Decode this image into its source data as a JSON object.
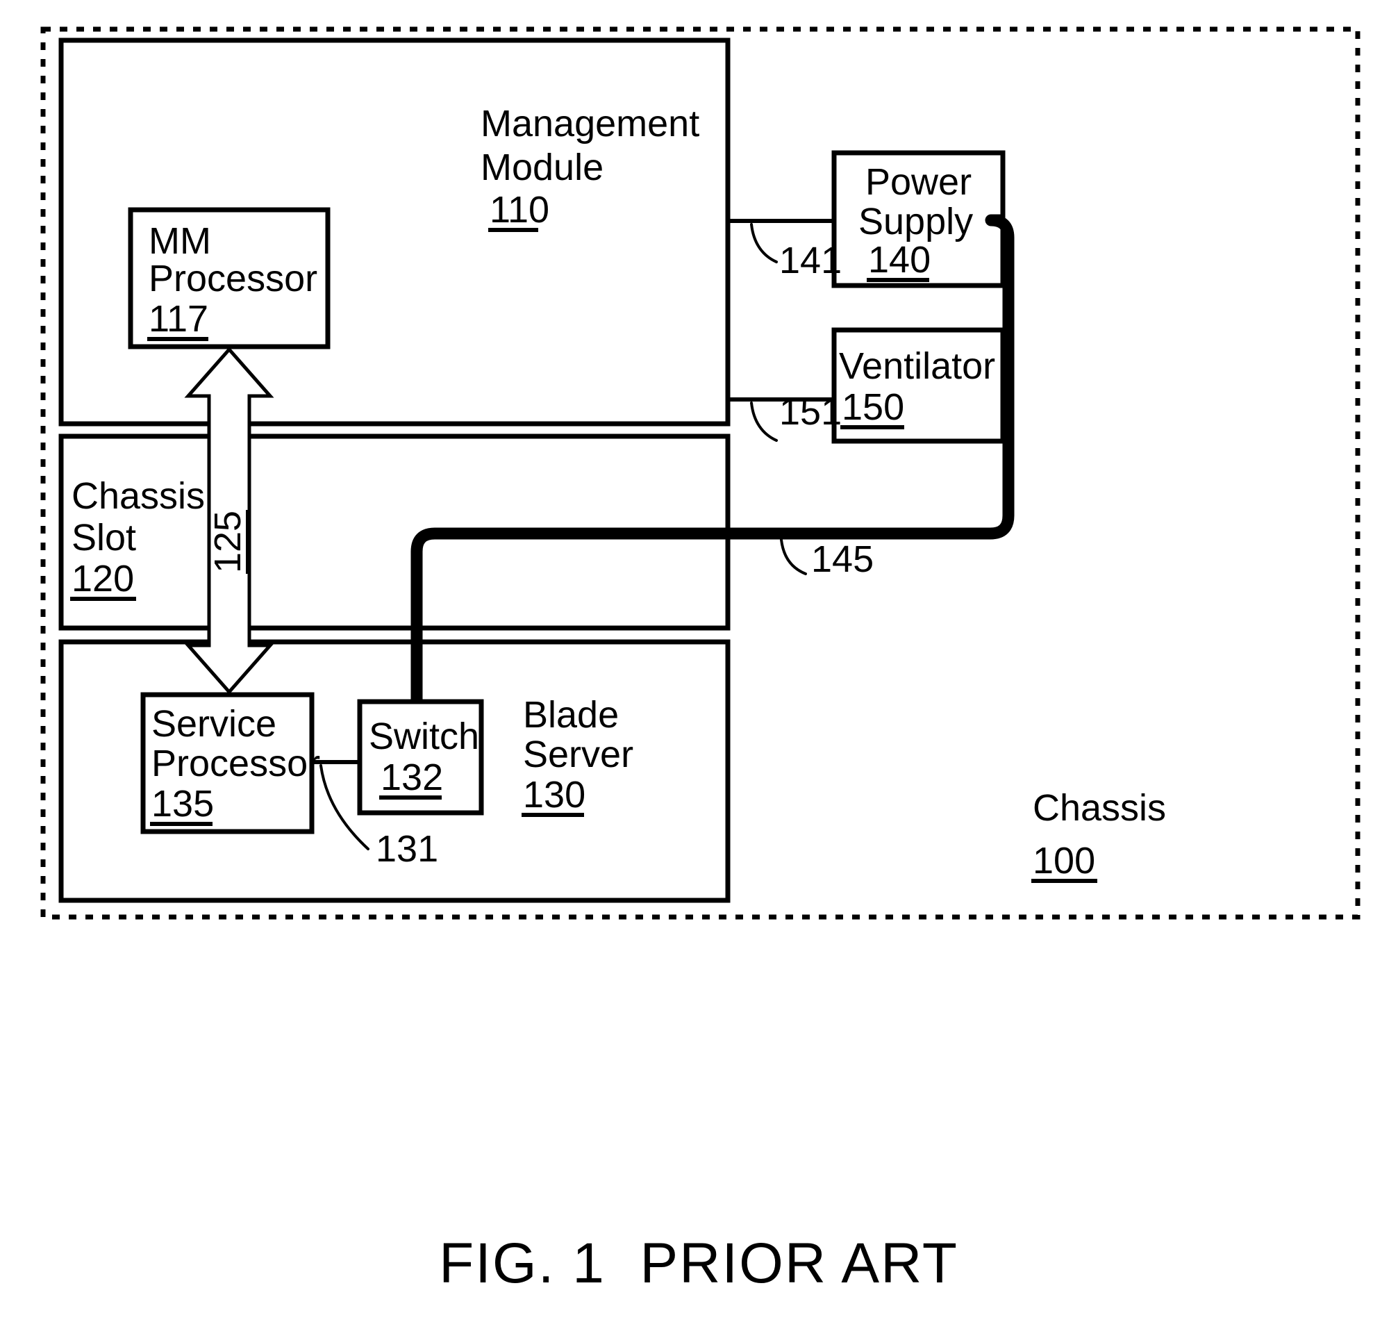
{
  "figure": {
    "caption": "FIG. 1  PRIOR ART",
    "outer_container": {
      "label": "Chassis",
      "number": "100"
    }
  },
  "blocks": {
    "management_module": {
      "label_line1": "Management",
      "label_line2": "Module",
      "number": "110"
    },
    "mm_processor": {
      "label_line1": "MM",
      "label_line2": "Processor",
      "number": "117"
    },
    "chassis_slot": {
      "label_line1": "Chassis",
      "label_line2": "Slot",
      "number": "120"
    },
    "blade_server": {
      "label_line1": "Blade",
      "label_line2": "Server",
      "number": "130"
    },
    "service_processor": {
      "label_line1": "Service",
      "label_line2": "Processor",
      "number": "135"
    },
    "switch": {
      "label_line1": "Switch",
      "number": "132"
    },
    "power_supply": {
      "label_line1": "Power",
      "label_line2": "Supply",
      "number": "140"
    },
    "ventilator": {
      "label_line1": "Ventilator",
      "number": "150"
    }
  },
  "connectors": {
    "mm_to_power_supply": "141",
    "mm_to_ventilator": "151",
    "bus_between_mm_and_service_processor": "125",
    "power_cable_to_switch": "145",
    "service_processor_to_switch": "131"
  },
  "colors": {
    "ink": "#000000",
    "paper": "#ffffff"
  }
}
